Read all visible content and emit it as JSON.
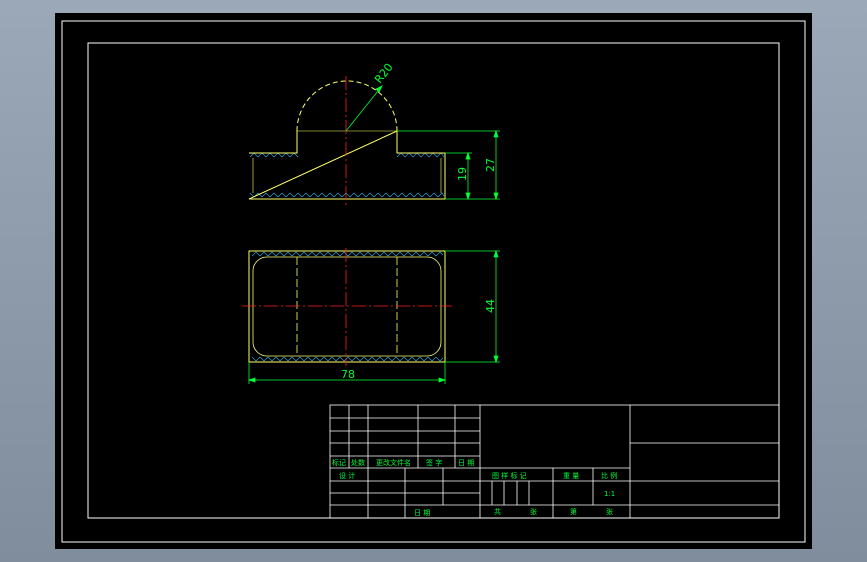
{
  "colors": {
    "background": "#000000",
    "frame": "#ffffff",
    "outline": "#ffff66",
    "center_line": "#ff2020",
    "dimension": "#00ff33",
    "hatch": "#33bbff",
    "title_text": "#00ff33",
    "window": "#8d9bab"
  },
  "dimensions": {
    "radius": "R20",
    "height_step": "19",
    "height_total": "27",
    "width_total": "44",
    "length_total": "78"
  },
  "title_block": {
    "rev_row": [
      "标记",
      "处数",
      "更改文件名",
      "签 字",
      "日 期"
    ],
    "design_label": "设 计",
    "date_label": "日 期",
    "fig_label": "图 样 标 记",
    "weight_label": "重 量",
    "scale_label": "比 例",
    "scale_value": "1:1",
    "total_label": "共",
    "sheet_unit": "张",
    "page_label": "第",
    "page_unit": "张"
  }
}
